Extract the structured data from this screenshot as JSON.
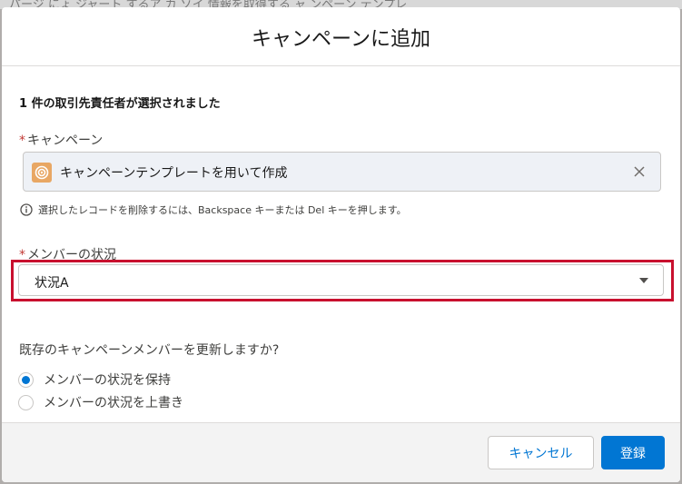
{
  "backdrop": {
    "text": "パージ にょ ジャート するア カ ゾイ 情報を取得する ャ ンペーン テンプレ"
  },
  "modal": {
    "title": "キャンペーンに追加",
    "selected_message": "1 件の取引先責任者が選択されました",
    "campaign": {
      "required_mark": "*",
      "label": "キャンペーン",
      "value": "キャンペーンテンプレートを用いて作成",
      "icon": "campaign-target-icon",
      "clear_icon": "close-icon",
      "help_text": "選択したレコードを削除するには、Backspace キーまたは Del キーを押します。"
    },
    "member_status": {
      "required_mark": "*",
      "label": "メンバーの状況",
      "value": "状況A"
    },
    "update_existing": {
      "question": "既存のキャンペーンメンバーを更新しますか?",
      "options": [
        {
          "label": "メンバーの状況を保持",
          "checked": true
        },
        {
          "label": "メンバーの状況を上書き",
          "checked": false
        }
      ]
    },
    "footer": {
      "cancel_label": "キャンセル",
      "submit_label": "登録"
    }
  },
  "colors": {
    "brand": "#0176d3",
    "highlight": "#c8102e",
    "campaign_icon": "#e8a764",
    "required": "#c23934"
  }
}
